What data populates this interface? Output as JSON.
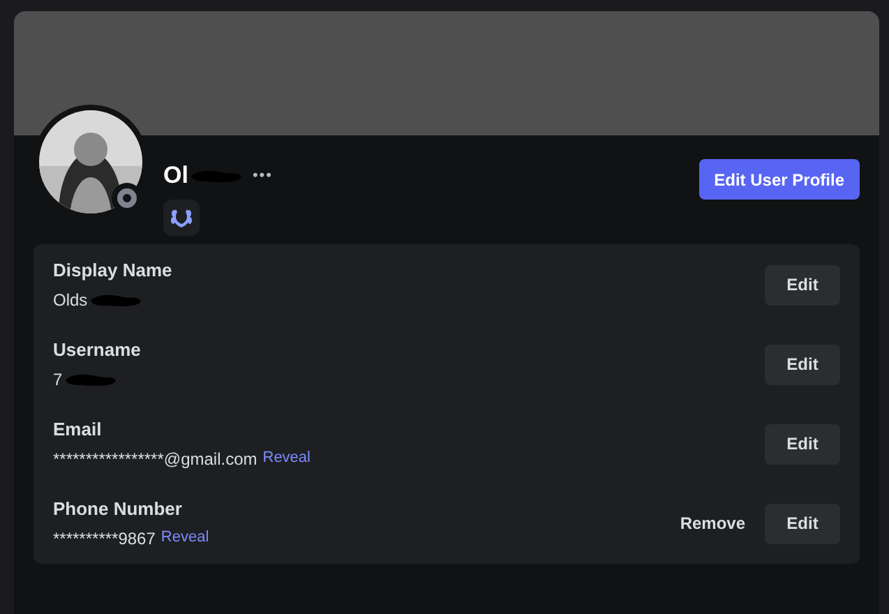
{
  "profile": {
    "name": "Ol",
    "name_redacted": true,
    "more": "•••",
    "edit_button": "Edit User Profile",
    "offline": true
  },
  "fields": [
    {
      "label": "Display Name",
      "value": "Olds",
      "redacted": true,
      "buttons": [
        "Edit"
      ]
    },
    {
      "label": "Username",
      "value": "7",
      "redacted": true,
      "buttons": [
        "Edit"
      ]
    },
    {
      "label": "Email",
      "value": "*****************@gmail.com",
      "redacted": false,
      "link": "Reveal",
      "buttons": [
        "Edit"
      ]
    },
    {
      "label": "Phone Number",
      "value": "**********9867",
      "redacted": false,
      "link": "Reveal",
      "secondary": "Remove",
      "buttons": [
        "Edit"
      ]
    }
  ]
}
